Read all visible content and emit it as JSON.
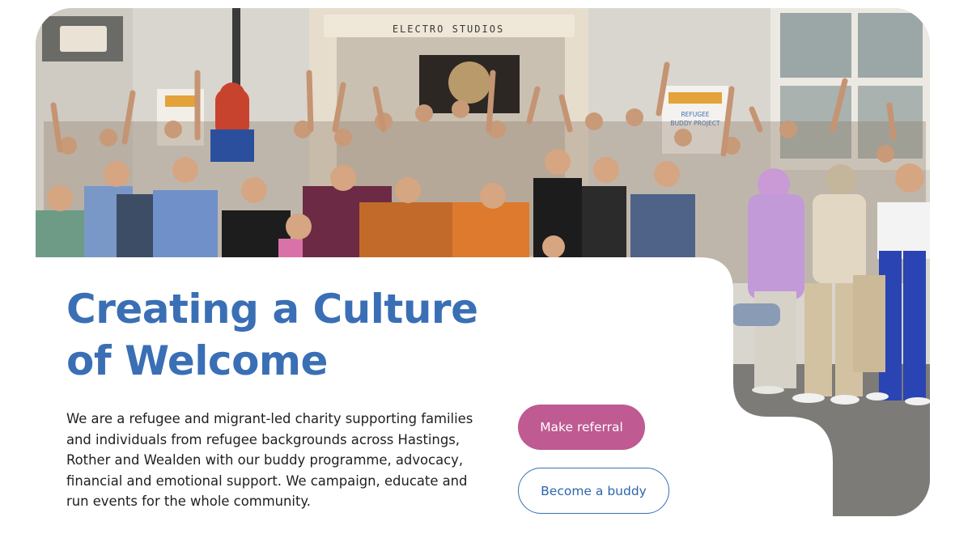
{
  "hero": {
    "photo_alt": "Group photo of people cheering outside a studio",
    "building_sign": "ELECTRO STUDIOS",
    "banner_text": "REFUGEE BUDDY PROJECT",
    "title": "Creating a Culture of Welcome",
    "description": "We are a refugee and migrant-led charity supporting families and individuals from refugee backgrounds across Hastings, Rother and Wealden with our buddy programme, advocacy, financial and emotional support. We campaign, educate and run events for the whole community."
  },
  "actions": {
    "referral_label": "Make referral",
    "buddy_label": "Become a buddy"
  },
  "colors": {
    "title": "#3a6fb5",
    "referral_button": "#bf5a92",
    "buddy_border": "#3a6fb5",
    "body_text": "#1f1f1f"
  }
}
